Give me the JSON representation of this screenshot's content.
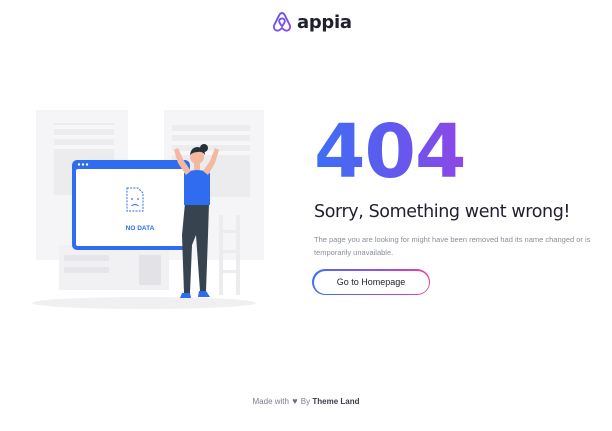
{
  "header": {
    "logo_icon": "airbnb-style-loop-icon",
    "logo_text": "appia"
  },
  "illustration": {
    "screen_label": "NO DATA",
    "icons": [
      "sad-document-icon",
      "woman-figure-icon"
    ]
  },
  "error": {
    "code": "404",
    "heading": "Sorry, Something went wrong!",
    "description": "The page you are looking for might have been removed had its name changed or is temporarily unavailable.",
    "button_label": "Go to Homepage"
  },
  "footer": {
    "made_with": "Made with",
    "heart_icon": "heart-icon",
    "by": "By",
    "brand": "Theme Land"
  },
  "colors": {
    "gradient_start": "#3f6ef5",
    "gradient_end": "#8f47e6",
    "button_gradient_end": "#e8409a",
    "text_dark": "#1f1f2e",
    "text_muted": "#8a8e9a",
    "illustration_blue": "#2f6cf0"
  }
}
